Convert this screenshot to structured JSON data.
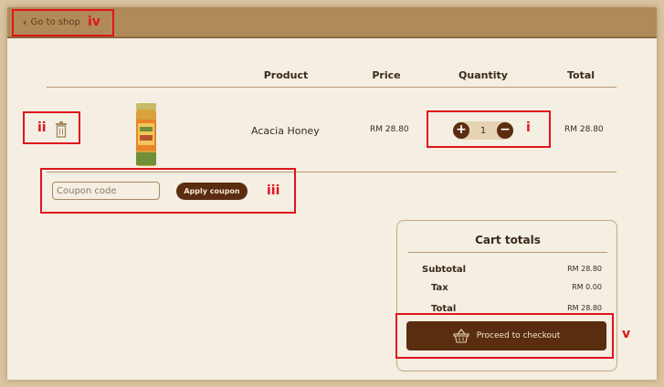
{
  "header": {
    "back_label": "Go to shop"
  },
  "annotations": {
    "i": "i",
    "ii": "ii",
    "iii": "iii",
    "iv": "iv",
    "v": "v"
  },
  "cart": {
    "columns": [
      "Product",
      "Price",
      "Quantity",
      "Total"
    ],
    "items": [
      {
        "name": "Acacia Honey",
        "price": "RM 28.80",
        "quantity": "1",
        "total": "RM 28.80"
      }
    ]
  },
  "coupon": {
    "placeholder": "Coupon code",
    "apply_label": "Apply coupon"
  },
  "totals": {
    "title": "Cart totals",
    "subtotal_label": "Subtotal",
    "subtotal_value": "RM 28.80",
    "tax_label": "Tax",
    "tax_value": "RM 0.00",
    "total_label": "Total",
    "total_value": "RM 28.80",
    "checkout_label": "Proceed to checkout"
  },
  "colors": {
    "accent": "#5a2c10",
    "header_bar": "#b18b57",
    "annotation": "#e0141b"
  },
  "icons": [
    "chevron-left-icon",
    "trash-icon",
    "plus-icon",
    "minus-icon",
    "basket-icon"
  ]
}
